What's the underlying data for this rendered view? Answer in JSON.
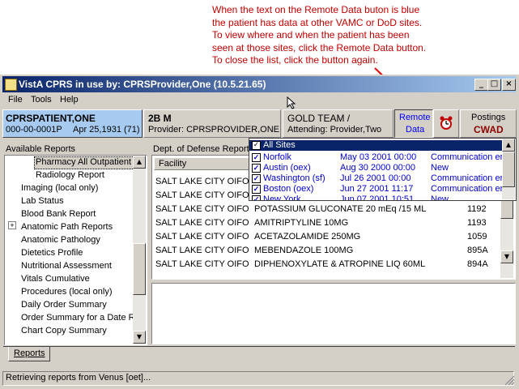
{
  "annotation": "When the text on the Remote Data buton is blue\nthe patient has data at other VAMC or DoD sites.\nTo view where and when the patient has been\nseen at those sites, click the Remote Data button.\nTo close the list, click the button again.",
  "window": {
    "title": "VistA CPRS in use by:  CPRSProvider,One  (10.5.21.65)",
    "btn_min": "_",
    "btn_max": "□",
    "btn_close": "×"
  },
  "menu": {
    "file": "File",
    "tools": "Tools",
    "help": "Help"
  },
  "patient": {
    "name": "CPRSPATIENT,ONE",
    "ssn": "000-00-0001P",
    "dob": "Apr 25,1931 (71)"
  },
  "location": {
    "ward": "2B M",
    "provider": "Provider: CPRSPROVIDER,ONE"
  },
  "team": {
    "name": "GOLD TEAM /",
    "attending": "Attending: Provider,Two"
  },
  "remote": {
    "line1": "Remote",
    "line2": "Data"
  },
  "postings": {
    "label": "Postings",
    "cwad": "CWAD"
  },
  "reports": {
    "header": "Available Reports",
    "items": [
      {
        "label": "Pharmacy All Outpatient",
        "selected": true
      },
      {
        "label": "Radiology Report"
      },
      {
        "label": "Imaging (local only)"
      },
      {
        "label": "Lab Status"
      },
      {
        "label": "Blood Bank Report"
      },
      {
        "label": "Anatomic Path Reports",
        "expand": "+"
      },
      {
        "label": "Anatomic Pathology"
      },
      {
        "label": "Dietetics Profile"
      },
      {
        "label": "Nutritional Assessment"
      },
      {
        "label": "Vitals Cumulative"
      },
      {
        "label": "Procedures (local only)"
      },
      {
        "label": "Daily Order Summary"
      },
      {
        "label": "Order Summary for a Date Ra"
      },
      {
        "label": "Chart Copy Summary"
      }
    ]
  },
  "dod": {
    "header": "Dept. of Defense Report",
    "column": "Facility",
    "rows": [
      {
        "facility": "SALT LAKE CITY OIFO",
        "drug": "",
        "code": ""
      },
      {
        "facility": "SALT LAKE CITY OIFO",
        "drug": "",
        "code": ""
      },
      {
        "facility": "SALT LAKE CITY OIFO",
        "drug": "POTASSIUM GLUCONATE 20 mEq /15 ML",
        "code": "1192"
      },
      {
        "facility": "SALT LAKE CITY OIFO",
        "drug": "AMITRIPTYLINE 10MG",
        "code": "1193"
      },
      {
        "facility": "SALT LAKE CITY OIFO",
        "drug": "ACETAZOLAMIDE 250MG",
        "code": "1059"
      },
      {
        "facility": "SALT LAKE CITY OIFO",
        "drug": "MEBENDAZOLE 100MG",
        "code": "895A"
      },
      {
        "facility": "SALT LAKE CITY OIFO",
        "drug": "DIPHENOXYLATE & ATROPINE LIQ 60ML",
        "code": "894A"
      }
    ]
  },
  "sites": {
    "all": "All Sites",
    "rows": [
      {
        "name": "Norfolk",
        "date": "May 03 2001 00:00",
        "status": "Communication err"
      },
      {
        "name": "Austin (oex)",
        "date": "Aug 30 2000 00:00",
        "status": "New"
      },
      {
        "name": "Washington (sf)",
        "date": "Jul 26 2001 00:00",
        "status": "Communication err"
      },
      {
        "name": "Boston (oex)",
        "date": "Jun 27 2001 11:17",
        "status": "Communication err"
      },
      {
        "name": "New York",
        "date": "Jun 07 2001 10:51",
        "status": "New"
      }
    ]
  },
  "tabs": {
    "reports": "Reports"
  },
  "status": "Retrieving reports from Venus [oet]..."
}
